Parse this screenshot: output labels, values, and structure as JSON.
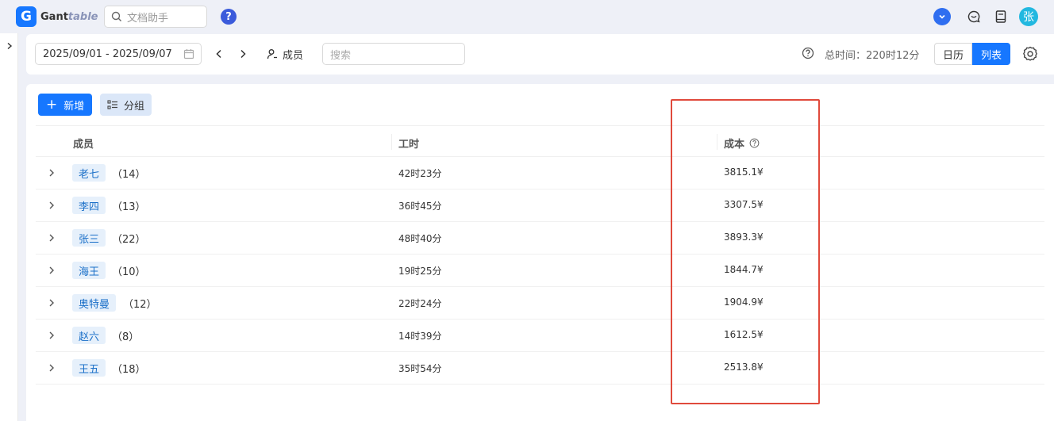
{
  "app": {
    "logo_letter": "G",
    "name_main": "Gant",
    "name_accent": "table",
    "search_placeholder": "文档助手",
    "avatar_text": "张"
  },
  "filter": {
    "date_range": "2025/09/01 - 2025/09/07",
    "members_label": "成员",
    "search_placeholder": "搜索",
    "total_time": "总时间：220时12分",
    "view_calendar": "日历",
    "view_list": "列表"
  },
  "actions": {
    "new_label": "新增",
    "group_label": "分组"
  },
  "table": {
    "columns": {
      "member": "成员",
      "hours": "工时",
      "cost": "成本"
    },
    "rows": [
      {
        "name": "老七",
        "count": "（14）",
        "hours": "42时23分",
        "cost": "3815.1¥"
      },
      {
        "name": "李四",
        "count": "（13）",
        "hours": "36时45分",
        "cost": "3307.5¥"
      },
      {
        "name": "张三",
        "count": "（22）",
        "hours": "48时40分",
        "cost": "3893.3¥"
      },
      {
        "name": "海王",
        "count": "（10）",
        "hours": "19时25分",
        "cost": "1844.7¥"
      },
      {
        "name": "奥特曼",
        "count": "（12）",
        "hours": "22时24分",
        "cost": "1904.9¥"
      },
      {
        "name": "赵六",
        "count": "（8）",
        "hours": "14时39分",
        "cost": "1612.5¥"
      },
      {
        "name": "王五",
        "count": "（18）",
        "hours": "35时54分",
        "cost": "2513.8¥"
      }
    ]
  },
  "colors": {
    "primary": "#1677ff",
    "tag_bg": "#e6f0fb",
    "highlight_border": "#e04a3c"
  }
}
